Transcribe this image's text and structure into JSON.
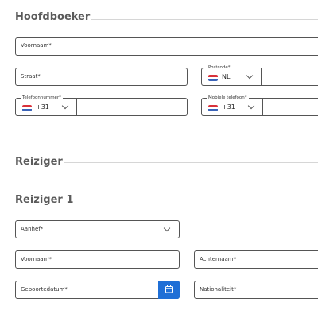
{
  "hoofdboeker": {
    "title": "Hoofdboeker",
    "voornaam_label": "Voornaam*",
    "straat_label": "Straat*",
    "postcode_label": "Postcode*",
    "postcode_country": "NL",
    "telefoon_label": "Telefoonnummer*",
    "telefoon_code": "+31",
    "mobiel_label": "Mobiele telefoon*",
    "mobiel_code": "+31"
  },
  "reiziger_section": {
    "title": "Reiziger"
  },
  "reiziger1": {
    "title": "Reiziger 1",
    "aanhef_label": "Aanhef*",
    "voornaam_label": "Voornaam*",
    "achternaam_label": "Achternaam*",
    "geboortedatum_label": "Geboortedatum*",
    "nationaliteit_label": "Nationaliteit*"
  },
  "colors": {
    "accent": "#1f6fd6",
    "flag_red": "#d9323a",
    "flag_white": "#ffffff",
    "flag_blue": "#3a63b8"
  }
}
